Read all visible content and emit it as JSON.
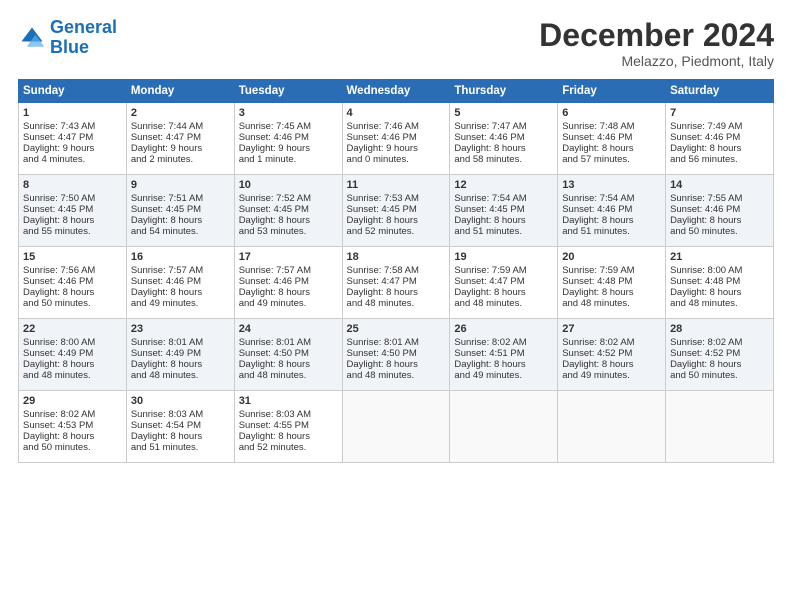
{
  "header": {
    "logo_line1": "General",
    "logo_line2": "Blue",
    "month": "December 2024",
    "location": "Melazzo, Piedmont, Italy"
  },
  "days_of_week": [
    "Sunday",
    "Monday",
    "Tuesday",
    "Wednesday",
    "Thursday",
    "Friday",
    "Saturday"
  ],
  "weeks": [
    [
      {
        "day": "1",
        "lines": [
          "Sunrise: 7:43 AM",
          "Sunset: 4:47 PM",
          "Daylight: 9 hours",
          "and 4 minutes."
        ]
      },
      {
        "day": "2",
        "lines": [
          "Sunrise: 7:44 AM",
          "Sunset: 4:47 PM",
          "Daylight: 9 hours",
          "and 2 minutes."
        ]
      },
      {
        "day": "3",
        "lines": [
          "Sunrise: 7:45 AM",
          "Sunset: 4:46 PM",
          "Daylight: 9 hours",
          "and 1 minute."
        ]
      },
      {
        "day": "4",
        "lines": [
          "Sunrise: 7:46 AM",
          "Sunset: 4:46 PM",
          "Daylight: 9 hours",
          "and 0 minutes."
        ]
      },
      {
        "day": "5",
        "lines": [
          "Sunrise: 7:47 AM",
          "Sunset: 4:46 PM",
          "Daylight: 8 hours",
          "and 58 minutes."
        ]
      },
      {
        "day": "6",
        "lines": [
          "Sunrise: 7:48 AM",
          "Sunset: 4:46 PM",
          "Daylight: 8 hours",
          "and 57 minutes."
        ]
      },
      {
        "day": "7",
        "lines": [
          "Sunrise: 7:49 AM",
          "Sunset: 4:46 PM",
          "Daylight: 8 hours",
          "and 56 minutes."
        ]
      }
    ],
    [
      {
        "day": "8",
        "lines": [
          "Sunrise: 7:50 AM",
          "Sunset: 4:45 PM",
          "Daylight: 8 hours",
          "and 55 minutes."
        ]
      },
      {
        "day": "9",
        "lines": [
          "Sunrise: 7:51 AM",
          "Sunset: 4:45 PM",
          "Daylight: 8 hours",
          "and 54 minutes."
        ]
      },
      {
        "day": "10",
        "lines": [
          "Sunrise: 7:52 AM",
          "Sunset: 4:45 PM",
          "Daylight: 8 hours",
          "and 53 minutes."
        ]
      },
      {
        "day": "11",
        "lines": [
          "Sunrise: 7:53 AM",
          "Sunset: 4:45 PM",
          "Daylight: 8 hours",
          "and 52 minutes."
        ]
      },
      {
        "day": "12",
        "lines": [
          "Sunrise: 7:54 AM",
          "Sunset: 4:45 PM",
          "Daylight: 8 hours",
          "and 51 minutes."
        ]
      },
      {
        "day": "13",
        "lines": [
          "Sunrise: 7:54 AM",
          "Sunset: 4:46 PM",
          "Daylight: 8 hours",
          "and 51 minutes."
        ]
      },
      {
        "day": "14",
        "lines": [
          "Sunrise: 7:55 AM",
          "Sunset: 4:46 PM",
          "Daylight: 8 hours",
          "and 50 minutes."
        ]
      }
    ],
    [
      {
        "day": "15",
        "lines": [
          "Sunrise: 7:56 AM",
          "Sunset: 4:46 PM",
          "Daylight: 8 hours",
          "and 50 minutes."
        ]
      },
      {
        "day": "16",
        "lines": [
          "Sunrise: 7:57 AM",
          "Sunset: 4:46 PM",
          "Daylight: 8 hours",
          "and 49 minutes."
        ]
      },
      {
        "day": "17",
        "lines": [
          "Sunrise: 7:57 AM",
          "Sunset: 4:46 PM",
          "Daylight: 8 hours",
          "and 49 minutes."
        ]
      },
      {
        "day": "18",
        "lines": [
          "Sunrise: 7:58 AM",
          "Sunset: 4:47 PM",
          "Daylight: 8 hours",
          "and 48 minutes."
        ]
      },
      {
        "day": "19",
        "lines": [
          "Sunrise: 7:59 AM",
          "Sunset: 4:47 PM",
          "Daylight: 8 hours",
          "and 48 minutes."
        ]
      },
      {
        "day": "20",
        "lines": [
          "Sunrise: 7:59 AM",
          "Sunset: 4:48 PM",
          "Daylight: 8 hours",
          "and 48 minutes."
        ]
      },
      {
        "day": "21",
        "lines": [
          "Sunrise: 8:00 AM",
          "Sunset: 4:48 PM",
          "Daylight: 8 hours",
          "and 48 minutes."
        ]
      }
    ],
    [
      {
        "day": "22",
        "lines": [
          "Sunrise: 8:00 AM",
          "Sunset: 4:49 PM",
          "Daylight: 8 hours",
          "and 48 minutes."
        ]
      },
      {
        "day": "23",
        "lines": [
          "Sunrise: 8:01 AM",
          "Sunset: 4:49 PM",
          "Daylight: 8 hours",
          "and 48 minutes."
        ]
      },
      {
        "day": "24",
        "lines": [
          "Sunrise: 8:01 AM",
          "Sunset: 4:50 PM",
          "Daylight: 8 hours",
          "and 48 minutes."
        ]
      },
      {
        "day": "25",
        "lines": [
          "Sunrise: 8:01 AM",
          "Sunset: 4:50 PM",
          "Daylight: 8 hours",
          "and 48 minutes."
        ]
      },
      {
        "day": "26",
        "lines": [
          "Sunrise: 8:02 AM",
          "Sunset: 4:51 PM",
          "Daylight: 8 hours",
          "and 49 minutes."
        ]
      },
      {
        "day": "27",
        "lines": [
          "Sunrise: 8:02 AM",
          "Sunset: 4:52 PM",
          "Daylight: 8 hours",
          "and 49 minutes."
        ]
      },
      {
        "day": "28",
        "lines": [
          "Sunrise: 8:02 AM",
          "Sunset: 4:52 PM",
          "Daylight: 8 hours",
          "and 50 minutes."
        ]
      }
    ],
    [
      {
        "day": "29",
        "lines": [
          "Sunrise: 8:02 AM",
          "Sunset: 4:53 PM",
          "Daylight: 8 hours",
          "and 50 minutes."
        ]
      },
      {
        "day": "30",
        "lines": [
          "Sunrise: 8:03 AM",
          "Sunset: 4:54 PM",
          "Daylight: 8 hours",
          "and 51 minutes."
        ]
      },
      {
        "day": "31",
        "lines": [
          "Sunrise: 8:03 AM",
          "Sunset: 4:55 PM",
          "Daylight: 8 hours",
          "and 52 minutes."
        ]
      },
      null,
      null,
      null,
      null
    ]
  ]
}
